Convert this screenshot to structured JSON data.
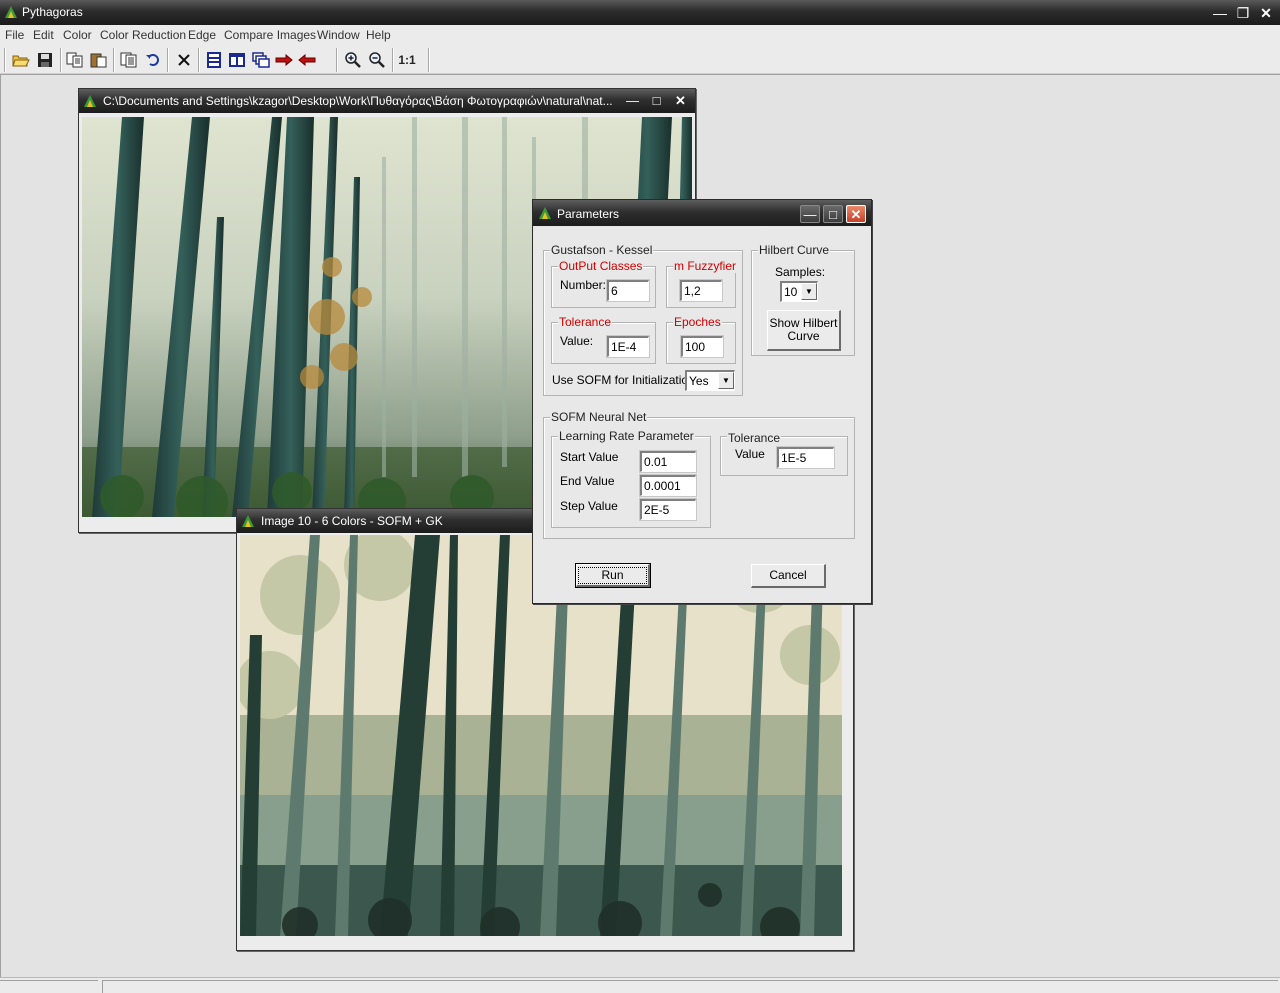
{
  "app": {
    "title": "Pythagoras"
  },
  "menu": [
    "File",
    "Edit",
    "Color",
    "Color Reduction",
    "Edge",
    "Compare Images",
    "Window",
    "Help"
  ],
  "toolbar": {
    "zoom_actual_label": "1:1"
  },
  "windows": {
    "original": {
      "title": "C:\\Documents and Settings\\kzagor\\Desktop\\Work\\Πυθαγόρας\\Βάση Φωτογραφιών\\natural\\nat..."
    },
    "result": {
      "title": "Image 10 - 6 Colors - SOFM + GK"
    }
  },
  "dialog": {
    "title": "Parameters",
    "gk": {
      "group_label": "Gustafson - Kessel",
      "output_classes": {
        "label": "OutPut Classes",
        "field_label": "Number:",
        "value": "6"
      },
      "m_fuzzyfier": {
        "label": "m Fuzzyfier",
        "value": "1,2"
      },
      "tolerance": {
        "label": "Tolerance",
        "field_label": "Value:",
        "value": "1E-4"
      },
      "epoches": {
        "label": "Epoches",
        "value": "100"
      },
      "use_sofm": {
        "label": "Use SOFM for Initialization:",
        "value": "Yes"
      }
    },
    "hilbert": {
      "group_label": "Hilbert Curve",
      "samples_label": "Samples:",
      "samples_value": "10",
      "show_button": "Show Hilbert Curve"
    },
    "sofm": {
      "group_label": "SOFM Neural Net",
      "learning_rate": {
        "group_label": "Learning Rate Parameter",
        "start_label": "Start Value",
        "start_value": "0.01",
        "end_label": "End Value",
        "end_value": "0.0001",
        "step_label": "Step Value",
        "step_value": "2E-5"
      },
      "tolerance": {
        "group_label": "Tolerance",
        "field_label": "Value",
        "value": "1E-5"
      }
    },
    "run_label": "Run",
    "cancel_label": "Cancel"
  }
}
